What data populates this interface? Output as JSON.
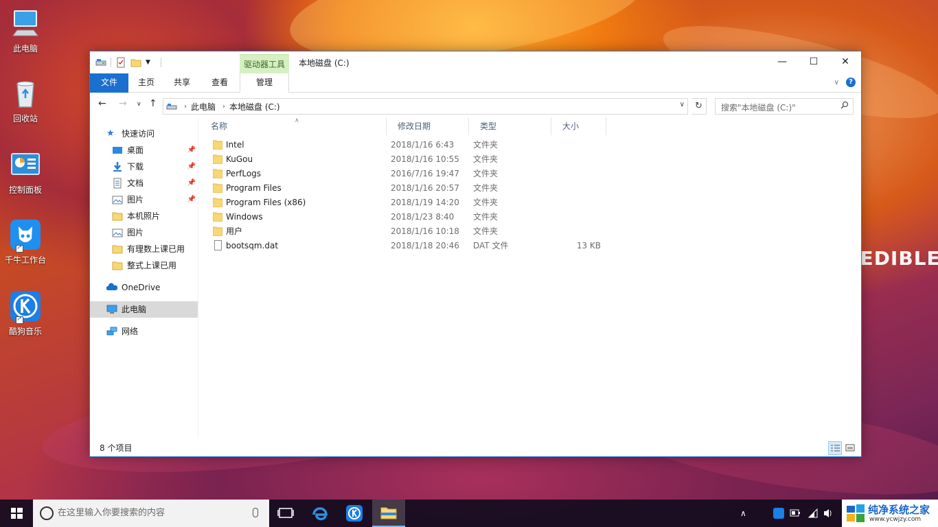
{
  "desktop": {
    "icons": [
      {
        "label": "此电脑",
        "icon": "this-pc-icon"
      },
      {
        "label": "回收站",
        "icon": "recycle-bin-icon"
      },
      {
        "label": "控制面板",
        "icon": "control-panel-icon"
      },
      {
        "label": "千牛工作台",
        "icon": "qianniu-icon"
      },
      {
        "label": "酷狗音乐",
        "icon": "kugou-icon"
      }
    ],
    "wallpaper_text": "REDIBLE"
  },
  "window": {
    "title": "本地磁盘 (C:)",
    "tool_tab_header": "驱动器工具",
    "ribbon_tabs": [
      "文件",
      "主页",
      "共享",
      "查看",
      "管理"
    ],
    "caption": {
      "minimize": "—",
      "maximize": "☐",
      "close": "✕"
    },
    "help": "?",
    "address": {
      "root_icon": "drive-icon",
      "crumbs": [
        "此电脑",
        "本地磁盘 (C:)"
      ]
    },
    "search_placeholder": "搜索\"本地磁盘 (C:)\"",
    "nav": {
      "quick_access": "快速访问",
      "pinned": [
        {
          "label": "桌面",
          "icon": "desktop-icon"
        },
        {
          "label": "下载",
          "icon": "download-icon"
        },
        {
          "label": "文档",
          "icon": "documents-icon"
        },
        {
          "label": "图片",
          "icon": "pictures-icon"
        }
      ],
      "recent": [
        {
          "label": "本机照片",
          "icon": "folder-icon"
        },
        {
          "label": "图片",
          "icon": "pictures-icon"
        },
        {
          "label": "有理数上课已用",
          "icon": "folder-icon"
        },
        {
          "label": "整式上课已用",
          "icon": "folder-icon"
        }
      ],
      "onedrive": "OneDrive",
      "this_pc": "此电脑",
      "network": "网络"
    },
    "columns": {
      "name": "名称",
      "date": "修改日期",
      "type": "类型",
      "size": "大小"
    },
    "files": [
      {
        "name": "Intel",
        "date": "2018/1/16 6:43",
        "type": "文件夹",
        "size": "",
        "kind": "folder"
      },
      {
        "name": "KuGou",
        "date": "2018/1/16 10:55",
        "type": "文件夹",
        "size": "",
        "kind": "folder"
      },
      {
        "name": "PerfLogs",
        "date": "2016/7/16 19:47",
        "type": "文件夹",
        "size": "",
        "kind": "folder"
      },
      {
        "name": "Program Files",
        "date": "2018/1/16 20:57",
        "type": "文件夹",
        "size": "",
        "kind": "folder"
      },
      {
        "name": "Program Files (x86)",
        "date": "2018/1/19 14:20",
        "type": "文件夹",
        "size": "",
        "kind": "folder"
      },
      {
        "name": "Windows",
        "date": "2018/1/23 8:40",
        "type": "文件夹",
        "size": "",
        "kind": "folder"
      },
      {
        "name": "用户",
        "date": "2018/1/16 10:18",
        "type": "文件夹",
        "size": "",
        "kind": "folder"
      },
      {
        "name": "bootsqm.dat",
        "date": "2018/1/18 20:46",
        "type": "DAT 文件",
        "size": "13 KB",
        "kind": "file"
      }
    ],
    "status": "8 个项目"
  },
  "taskbar": {
    "search_placeholder": "在这里输入你要搜索的内容",
    "brand_title": "纯净系统之家",
    "brand_url": "www.ycwjzy.com"
  },
  "colors": {
    "accent": "#1a6fcf",
    "tool_tab": "#d6f0c4",
    "folder": "#f8d775",
    "taskbar": "#120c1e"
  }
}
